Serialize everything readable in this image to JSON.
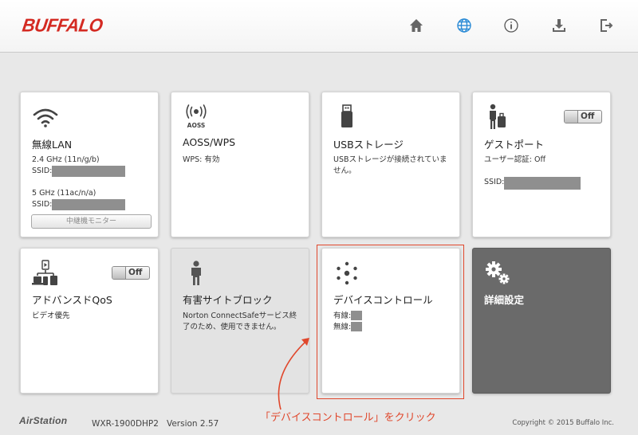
{
  "header": {
    "logo": "BUFFALO",
    "icons": [
      "home-icon",
      "globe-icon",
      "info-icon",
      "download-icon",
      "logout-icon"
    ],
    "accent": "#d42a22"
  },
  "tiles": {
    "wireless": {
      "title": "無線LAN",
      "band1": "2.4 GHz (11n/g/b)",
      "ssid_label1": "SSID:",
      "band2": "5 GHz (11ac/n/a)",
      "ssid_label2": "SSID:",
      "monitor_button": "中継機モニター"
    },
    "aoss": {
      "title": "AOSS/WPS",
      "icon_label": "AOSS",
      "status": "WPS: 有効"
    },
    "usb": {
      "title": "USBストレージ",
      "status": "USBストレージが接続されていません。"
    },
    "guest": {
      "title": "ゲストポート",
      "toggle": "Off",
      "auth": "ユーザー認証: Off",
      "ssid_label": "SSID:"
    },
    "qos": {
      "title": "アドバンスドQoS",
      "toggle": "Off",
      "status": "ビデオ優先"
    },
    "harmful": {
      "title": "有害サイトブロック",
      "status": "Norton ConnectSafeサービス終了のため、使用できません。"
    },
    "device": {
      "title": "デバイスコントロール",
      "wired_label": "有線:",
      "wireless_label": "無線:"
    },
    "advanced": {
      "title": "詳細設定"
    }
  },
  "annotation": {
    "text": "「デバイスコントロール」をクリック",
    "color": "#e0472c"
  },
  "footer": {
    "logo": "AirStation",
    "model": "WXR-1900DHP2   Version 2.57",
    "copyright": "Copyright © 2015 Buffalo Inc."
  }
}
